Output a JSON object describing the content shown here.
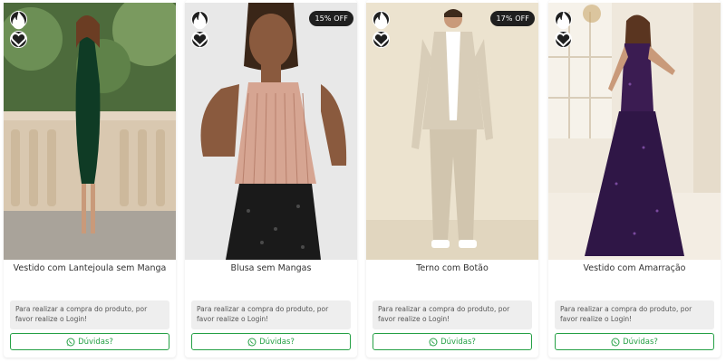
{
  "products": [
    {
      "name": "Vestido com Lantejoula sem Manga",
      "discount": "",
      "login_notice": "Para realizar a compra do produto, por favor realize o Login!",
      "whatsapp_label": "Dúvidas?"
    },
    {
      "name": "Blusa sem Mangas",
      "discount": "15% OFF",
      "login_notice": "Para realizar a compra do produto, por favor realize o Login!",
      "whatsapp_label": "Dúvidas?"
    },
    {
      "name": "Terno com Botão",
      "discount": "17% OFF",
      "login_notice": "Para realizar a compra do produto, por favor realize o Login!",
      "whatsapp_label": "Dúvidas?"
    },
    {
      "name": "Vestido com Amarração",
      "discount": "",
      "login_notice": "Para realizar a compra do produto, por favor realize o Login!",
      "whatsapp_label": "Dúvidas?"
    }
  ],
  "colors": {
    "whatsapp_green": "#25a045",
    "icon_bg": "#1f1f1f",
    "notice_bg": "#eeeeee"
  },
  "icons": {
    "hot": "fire-icon",
    "favorite": "heart-icon",
    "contact": "whatsapp-icon"
  }
}
